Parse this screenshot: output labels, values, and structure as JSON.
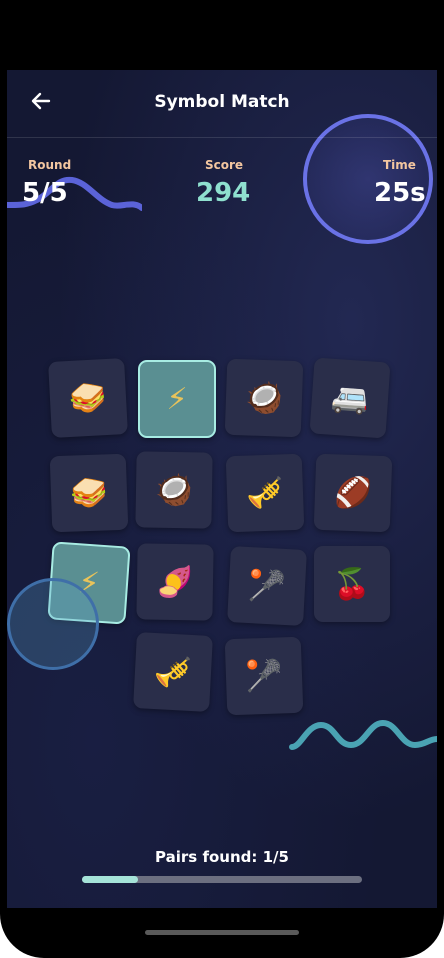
{
  "header": {
    "title": "Symbol Match",
    "back_icon": "arrow-left-icon"
  },
  "stats": {
    "round_label": "Round",
    "round_value": "5/5",
    "score_label": "Score",
    "score_value": "294",
    "time_label": "Time",
    "time_value": "25s"
  },
  "board": {
    "tiles": [
      {
        "symbol": "🥪",
        "name": "sandwich",
        "selected": false
      },
      {
        "symbol": "⚡",
        "name": "lightning",
        "selected": true
      },
      {
        "symbol": "🥥",
        "name": "coconut",
        "selected": false
      },
      {
        "symbol": "🚐",
        "name": "minibus",
        "selected": false
      },
      {
        "symbol": "🥪",
        "name": "sandwich",
        "selected": false
      },
      {
        "symbol": "🥥",
        "name": "coconut",
        "selected": false
      },
      {
        "symbol": "🎺",
        "name": "trumpet",
        "selected": false
      },
      {
        "symbol": "🏈",
        "name": "football",
        "selected": false
      },
      {
        "symbol": "⚡",
        "name": "lightning",
        "selected": true
      },
      {
        "symbol": "🍠",
        "name": "sweet-potato",
        "selected": false
      },
      {
        "symbol": "🥍",
        "name": "lacrosse",
        "selected": false
      },
      {
        "symbol": "🍒",
        "name": "cherries",
        "selected": false
      },
      {
        "symbol": "🎺",
        "name": "trumpet",
        "selected": false
      },
      {
        "symbol": "🥍",
        "name": "lacrosse",
        "selected": false
      }
    ]
  },
  "progress": {
    "pairs_text": "Pairs found: 1/5",
    "fraction": 0.2
  },
  "colors": {
    "background": "#141833",
    "accent_teal": "#a5e3d8",
    "score_color": "#8fe0cf",
    "label_color": "#f3c6a0",
    "deco_purple": "#6a72e6"
  }
}
